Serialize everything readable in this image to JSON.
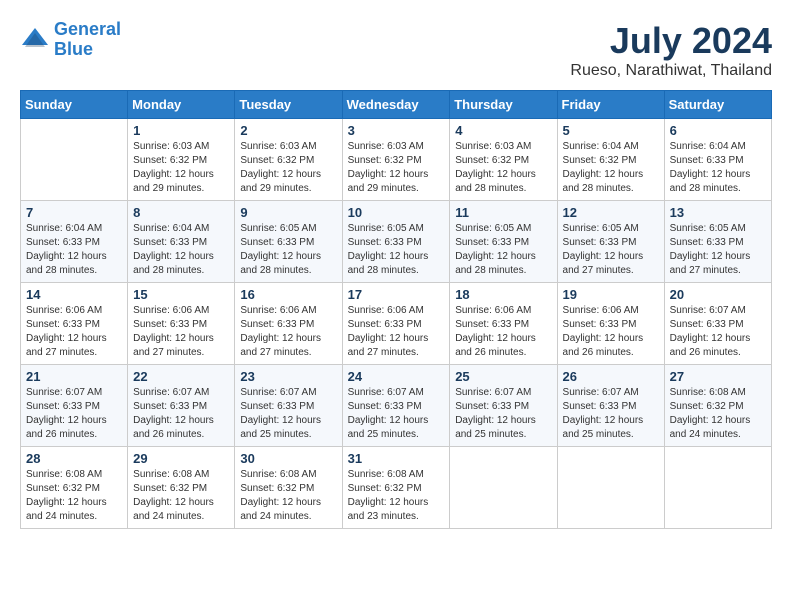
{
  "header": {
    "logo_line1": "General",
    "logo_line2": "Blue",
    "month": "July 2024",
    "location": "Rueso, Narathiwat, Thailand"
  },
  "weekdays": [
    "Sunday",
    "Monday",
    "Tuesday",
    "Wednesday",
    "Thursday",
    "Friday",
    "Saturday"
  ],
  "weeks": [
    [
      {
        "day": "",
        "sunrise": "",
        "sunset": "",
        "daylight": ""
      },
      {
        "day": "1",
        "sunrise": "Sunrise: 6:03 AM",
        "sunset": "Sunset: 6:32 PM",
        "daylight": "Daylight: 12 hours and 29 minutes."
      },
      {
        "day": "2",
        "sunrise": "Sunrise: 6:03 AM",
        "sunset": "Sunset: 6:32 PM",
        "daylight": "Daylight: 12 hours and 29 minutes."
      },
      {
        "day": "3",
        "sunrise": "Sunrise: 6:03 AM",
        "sunset": "Sunset: 6:32 PM",
        "daylight": "Daylight: 12 hours and 29 minutes."
      },
      {
        "day": "4",
        "sunrise": "Sunrise: 6:03 AM",
        "sunset": "Sunset: 6:32 PM",
        "daylight": "Daylight: 12 hours and 28 minutes."
      },
      {
        "day": "5",
        "sunrise": "Sunrise: 6:04 AM",
        "sunset": "Sunset: 6:32 PM",
        "daylight": "Daylight: 12 hours and 28 minutes."
      },
      {
        "day": "6",
        "sunrise": "Sunrise: 6:04 AM",
        "sunset": "Sunset: 6:33 PM",
        "daylight": "Daylight: 12 hours and 28 minutes."
      }
    ],
    [
      {
        "day": "7",
        "sunrise": "Sunrise: 6:04 AM",
        "sunset": "Sunset: 6:33 PM",
        "daylight": "Daylight: 12 hours and 28 minutes."
      },
      {
        "day": "8",
        "sunrise": "Sunrise: 6:04 AM",
        "sunset": "Sunset: 6:33 PM",
        "daylight": "Daylight: 12 hours and 28 minutes."
      },
      {
        "day": "9",
        "sunrise": "Sunrise: 6:05 AM",
        "sunset": "Sunset: 6:33 PM",
        "daylight": "Daylight: 12 hours and 28 minutes."
      },
      {
        "day": "10",
        "sunrise": "Sunrise: 6:05 AM",
        "sunset": "Sunset: 6:33 PM",
        "daylight": "Daylight: 12 hours and 28 minutes."
      },
      {
        "day": "11",
        "sunrise": "Sunrise: 6:05 AM",
        "sunset": "Sunset: 6:33 PM",
        "daylight": "Daylight: 12 hours and 28 minutes."
      },
      {
        "day": "12",
        "sunrise": "Sunrise: 6:05 AM",
        "sunset": "Sunset: 6:33 PM",
        "daylight": "Daylight: 12 hours and 27 minutes."
      },
      {
        "day": "13",
        "sunrise": "Sunrise: 6:05 AM",
        "sunset": "Sunset: 6:33 PM",
        "daylight": "Daylight: 12 hours and 27 minutes."
      }
    ],
    [
      {
        "day": "14",
        "sunrise": "Sunrise: 6:06 AM",
        "sunset": "Sunset: 6:33 PM",
        "daylight": "Daylight: 12 hours and 27 minutes."
      },
      {
        "day": "15",
        "sunrise": "Sunrise: 6:06 AM",
        "sunset": "Sunset: 6:33 PM",
        "daylight": "Daylight: 12 hours and 27 minutes."
      },
      {
        "day": "16",
        "sunrise": "Sunrise: 6:06 AM",
        "sunset": "Sunset: 6:33 PM",
        "daylight": "Daylight: 12 hours and 27 minutes."
      },
      {
        "day": "17",
        "sunrise": "Sunrise: 6:06 AM",
        "sunset": "Sunset: 6:33 PM",
        "daylight": "Daylight: 12 hours and 27 minutes."
      },
      {
        "day": "18",
        "sunrise": "Sunrise: 6:06 AM",
        "sunset": "Sunset: 6:33 PM",
        "daylight": "Daylight: 12 hours and 26 minutes."
      },
      {
        "day": "19",
        "sunrise": "Sunrise: 6:06 AM",
        "sunset": "Sunset: 6:33 PM",
        "daylight": "Daylight: 12 hours and 26 minutes."
      },
      {
        "day": "20",
        "sunrise": "Sunrise: 6:07 AM",
        "sunset": "Sunset: 6:33 PM",
        "daylight": "Daylight: 12 hours and 26 minutes."
      }
    ],
    [
      {
        "day": "21",
        "sunrise": "Sunrise: 6:07 AM",
        "sunset": "Sunset: 6:33 PM",
        "daylight": "Daylight: 12 hours and 26 minutes."
      },
      {
        "day": "22",
        "sunrise": "Sunrise: 6:07 AM",
        "sunset": "Sunset: 6:33 PM",
        "daylight": "Daylight: 12 hours and 26 minutes."
      },
      {
        "day": "23",
        "sunrise": "Sunrise: 6:07 AM",
        "sunset": "Sunset: 6:33 PM",
        "daylight": "Daylight: 12 hours and 25 minutes."
      },
      {
        "day": "24",
        "sunrise": "Sunrise: 6:07 AM",
        "sunset": "Sunset: 6:33 PM",
        "daylight": "Daylight: 12 hours and 25 minutes."
      },
      {
        "day": "25",
        "sunrise": "Sunrise: 6:07 AM",
        "sunset": "Sunset: 6:33 PM",
        "daylight": "Daylight: 12 hours and 25 minutes."
      },
      {
        "day": "26",
        "sunrise": "Sunrise: 6:07 AM",
        "sunset": "Sunset: 6:33 PM",
        "daylight": "Daylight: 12 hours and 25 minutes."
      },
      {
        "day": "27",
        "sunrise": "Sunrise: 6:08 AM",
        "sunset": "Sunset: 6:32 PM",
        "daylight": "Daylight: 12 hours and 24 minutes."
      }
    ],
    [
      {
        "day": "28",
        "sunrise": "Sunrise: 6:08 AM",
        "sunset": "Sunset: 6:32 PM",
        "daylight": "Daylight: 12 hours and 24 minutes."
      },
      {
        "day": "29",
        "sunrise": "Sunrise: 6:08 AM",
        "sunset": "Sunset: 6:32 PM",
        "daylight": "Daylight: 12 hours and 24 minutes."
      },
      {
        "day": "30",
        "sunrise": "Sunrise: 6:08 AM",
        "sunset": "Sunset: 6:32 PM",
        "daylight": "Daylight: 12 hours and 24 minutes."
      },
      {
        "day": "31",
        "sunrise": "Sunrise: 6:08 AM",
        "sunset": "Sunset: 6:32 PM",
        "daylight": "Daylight: 12 hours and 23 minutes."
      },
      {
        "day": "",
        "sunrise": "",
        "sunset": "",
        "daylight": ""
      },
      {
        "day": "",
        "sunrise": "",
        "sunset": "",
        "daylight": ""
      },
      {
        "day": "",
        "sunrise": "",
        "sunset": "",
        "daylight": ""
      }
    ]
  ]
}
